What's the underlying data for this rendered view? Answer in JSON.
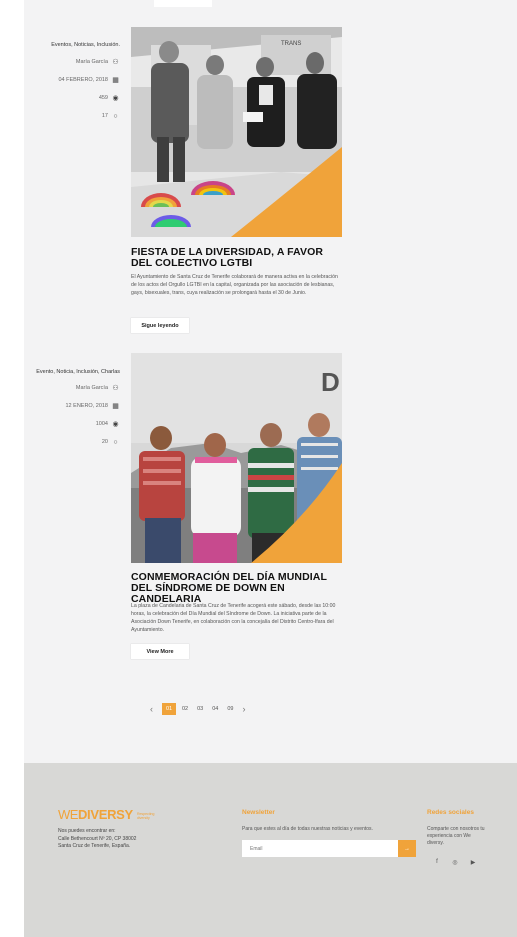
{
  "posts": [
    {
      "categories": "Eventos, Noticias, Inclusión.",
      "author": "María García",
      "date": "04 FEBRERO, 2018",
      "views": "459",
      "comments": "17",
      "title": "FIESTA DE LA DIVERSIDAD, A FAVOR DEL COLECTIVO LGTBI",
      "excerpt": "El Ayuntamiento de Santa Cruz de Tenerife colaborará de manera activa en la celebración de los actos del Orgullo LGTBI en la capital, organizada por las asociación de lesbianas, gays, bisexuales, trans, cuya realización se prolongará hasta el 30 de Junio.",
      "button": "Sigue leyendo",
      "image_sign": "TRANS"
    },
    {
      "categories": "Evento, Noticia, Inclusión, Charlas",
      "author": "María García",
      "date": "12 ENERO, 2018",
      "views": "1004",
      "comments": "20",
      "title": "CONMEMORACIÓN DEL DÍA MUNDIAL DEL SÍNDROME DE DOWN EN CANDELARIA",
      "excerpt": "La plaza de Candelaria de Santa Cruz de Tenerife acogerá este sábado, desde las 10:00 horas, la celebración del Día Mundial del Síndrome de Down. La iniciativa parte de la Asociación Down Tenerife, en colaboración con la concejalía del Distrito Centro-Ifara del Ayuntamiento.",
      "button": "View More",
      "image_sign": "D"
    }
  ],
  "pagination": {
    "prev": "‹",
    "pages": [
      "01",
      "02",
      "03",
      "04",
      "09"
    ],
    "active": "01",
    "next": "›"
  },
  "footer": {
    "logo_we": "WE",
    "logo_diversy": "DIVERSY",
    "logo_tagline": "Respecting diversity",
    "address": [
      "Nos puedes encontrar en:",
      "Calle Bethencourt Nº 20, CP 38002",
      "Santa Cruz de Tenerife, España."
    ],
    "newsletter_title": "Newsletter",
    "newsletter_text": "Para que estes al día de todas nuestras noticias y eventos.",
    "email_placeholder": "Email",
    "submit": "→",
    "social_title": "Redes sociales",
    "social_text": "Comparte con nosotros tu experiencia con We diversy.",
    "social_icons": [
      "f",
      "◎",
      "▶"
    ]
  },
  "colors": {
    "accent": "#f0a33a",
    "footer_bg": "#d8d8d6",
    "page_bg": "#f3f3f4"
  }
}
